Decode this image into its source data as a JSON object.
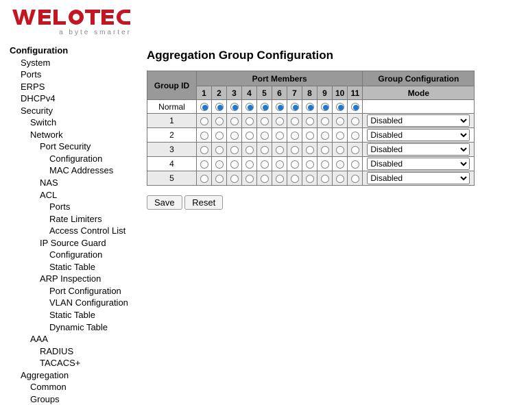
{
  "brand": {
    "name": "WELOTEC",
    "tagline": "a byte smarter",
    "color": "#c31622"
  },
  "nav": {
    "root": "Configuration",
    "items": [
      {
        "label": "System",
        "level": 1
      },
      {
        "label": "Ports",
        "level": 1
      },
      {
        "label": "ERPS",
        "level": 1
      },
      {
        "label": "DHCPv4",
        "level": 1
      },
      {
        "label": "Security",
        "level": 1
      },
      {
        "label": "Switch",
        "level": 2
      },
      {
        "label": "Network",
        "level": 2
      },
      {
        "label": "Port Security",
        "level": 3
      },
      {
        "label": "Configuration",
        "level": 4
      },
      {
        "label": "MAC Addresses",
        "level": 4
      },
      {
        "label": "NAS",
        "level": 3
      },
      {
        "label": "ACL",
        "level": 3
      },
      {
        "label": "Ports",
        "level": 4
      },
      {
        "label": "Rate Limiters",
        "level": 4
      },
      {
        "label": "Access Control List",
        "level": 4
      },
      {
        "label": "IP Source Guard",
        "level": 3
      },
      {
        "label": "Configuration",
        "level": 4
      },
      {
        "label": "Static Table",
        "level": 4
      },
      {
        "label": "ARP Inspection",
        "level": 3
      },
      {
        "label": "Port Configuration",
        "level": 4
      },
      {
        "label": "VLAN Configuration",
        "level": 4
      },
      {
        "label": "Static Table",
        "level": 4
      },
      {
        "label": "Dynamic Table",
        "level": 4
      },
      {
        "label": "AAA",
        "level": 2
      },
      {
        "label": "RADIUS",
        "level": 3
      },
      {
        "label": "TACACS+",
        "level": 3
      },
      {
        "label": "Aggregation",
        "level": 1
      },
      {
        "label": "Common",
        "level": 2
      },
      {
        "label": "Groups",
        "level": 2
      }
    ]
  },
  "page": {
    "title": "Aggregation Group Configuration",
    "headers": {
      "group_id": "Group ID",
      "port_members": "Port Members",
      "group_conf": "Group Configuration",
      "mode": "Mode"
    },
    "ports": [
      "1",
      "2",
      "3",
      "4",
      "5",
      "6",
      "7",
      "8",
      "9",
      "10",
      "11"
    ],
    "rows": [
      {
        "label": "Normal",
        "selected_all": true,
        "mode": null
      },
      {
        "label": "1",
        "selected_all": false,
        "mode": "Disabled"
      },
      {
        "label": "2",
        "selected_all": false,
        "mode": "Disabled"
      },
      {
        "label": "3",
        "selected_all": false,
        "mode": "Disabled"
      },
      {
        "label": "4",
        "selected_all": false,
        "mode": "Disabled"
      },
      {
        "label": "5",
        "selected_all": false,
        "mode": "Disabled"
      }
    ],
    "mode_options": [
      "Disabled"
    ],
    "buttons": {
      "save": "Save",
      "reset": "Reset"
    }
  }
}
